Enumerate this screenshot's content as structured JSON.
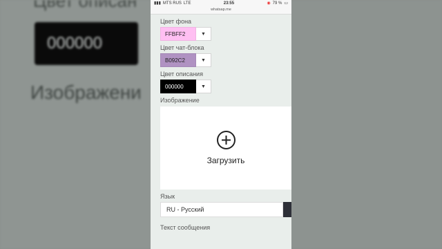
{
  "background": {
    "label_top": "Цвет описан",
    "box_value": "000000",
    "label_image": "Изображени"
  },
  "status_bar": {
    "carrier": "MTS RUS",
    "network": "LTE",
    "time": "23:55",
    "battery": "79 %"
  },
  "url": "whatsap.me",
  "fields": {
    "bg_color": {
      "label": "Цвет фона",
      "value": "FFBFF2",
      "color": "#FFBFF2"
    },
    "chat_color": {
      "label": "Цвет чат-блока",
      "value": "B092C2",
      "color": "#B092C2"
    },
    "desc_color": {
      "label": "Цвет описания",
      "value": "000000",
      "color": "#000000",
      "text_color": "#ffffff"
    },
    "image": {
      "label": "Изображение",
      "upload_label": "Загрузить",
      "icon": "plus-circle-icon"
    },
    "language": {
      "label": "Язык",
      "value": "RU - Русский"
    },
    "message": {
      "label": "Текст сообщения"
    }
  }
}
